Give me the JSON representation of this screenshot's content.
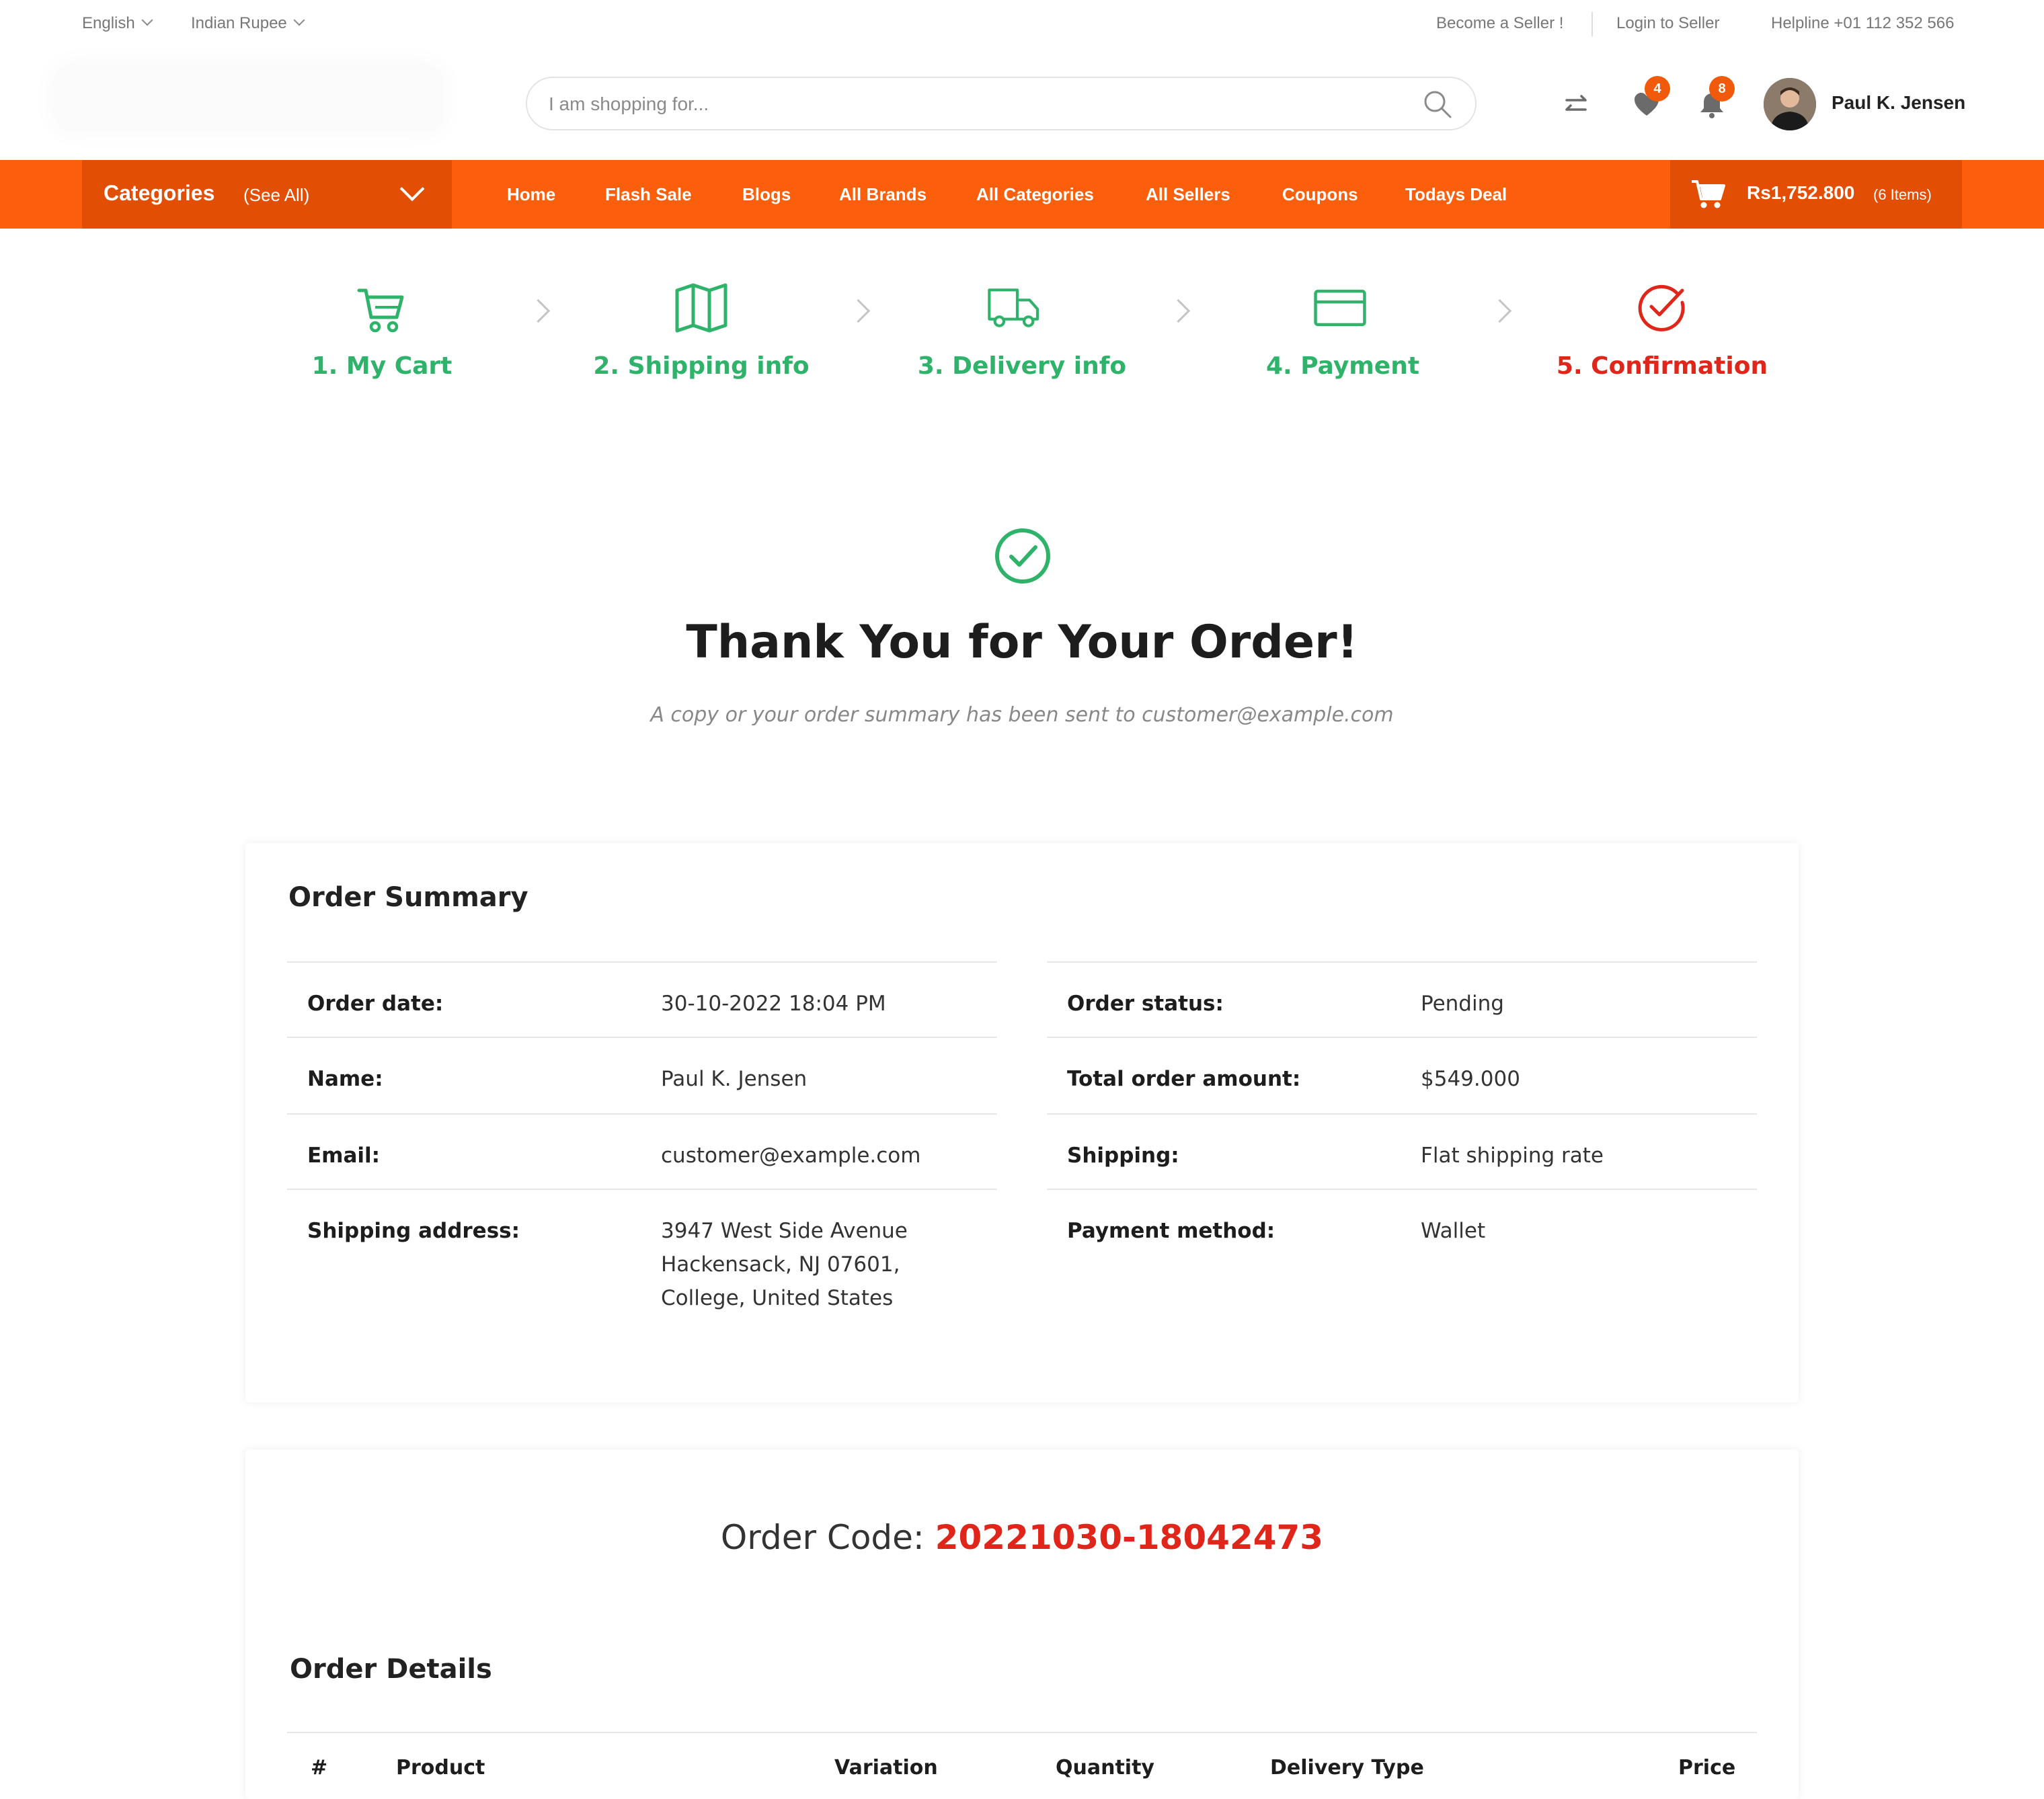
{
  "topbar": {
    "language": "English",
    "currency": "Indian Rupee",
    "become_seller": "Become a Seller !",
    "login_seller": "Login to Seller",
    "helpline": "Helpline +01 112 352 566"
  },
  "header": {
    "search_placeholder": "I am shopping for...",
    "wishlist_count": "4",
    "notification_count": "8",
    "user_name": "Paul K. Jensen",
    "icons": [
      "compare-icon",
      "heart-icon",
      "bell-icon",
      "search-icon"
    ]
  },
  "nav": {
    "categories_label": "Categories",
    "see_all": "(See All)",
    "items": [
      "Home",
      "Flash Sale",
      "Blogs",
      "All Brands",
      "All Categories",
      "All Sellers",
      "Coupons",
      "Todays Deal"
    ],
    "cart_amount": "Rs1,752.800",
    "cart_items": "(6 Items)"
  },
  "steps": [
    {
      "label": "1. My Cart",
      "icon": "cart-icon",
      "color": "#2fb36b"
    },
    {
      "label": "2. Shipping info",
      "icon": "map-icon",
      "color": "#2fb36b"
    },
    {
      "label": "3. Delivery info",
      "icon": "truck-icon",
      "color": "#2fb36b"
    },
    {
      "label": "4. Payment",
      "icon": "credit-card-icon",
      "color": "#2fb36b"
    },
    {
      "label": "5. Confirmation",
      "icon": "check-circle-icon",
      "color": "#e0261a"
    }
  ],
  "thank_you": {
    "title": "Thank You for Your Order!",
    "subtitle": "A copy or your order summary has been sent to customer@example.com"
  },
  "order_summary": {
    "title": "Order Summary",
    "left": [
      {
        "key": "Order date:",
        "value": "30-10-2022 18:04 PM"
      },
      {
        "key": "Name:",
        "value": "Paul K. Jensen"
      },
      {
        "key": "Email:",
        "value": "customer@example.com"
      },
      {
        "key": "Shipping address:",
        "value_lines": [
          "3947 West Side Avenue",
          "Hackensack, NJ 07601,",
          "College, United States"
        ]
      }
    ],
    "right": [
      {
        "key": "Order status:",
        "value": "Pending"
      },
      {
        "key": "Total order amount:",
        "value": "$549.000"
      },
      {
        "key": "Shipping:",
        "value": "Flat shipping rate"
      },
      {
        "key": "Payment method:",
        "value": "Wallet"
      }
    ]
  },
  "order_code": {
    "label": "Order Code:",
    "value": "20221030-18042473"
  },
  "order_details": {
    "title": "Order Details",
    "columns": [
      "#",
      "Product",
      "Variation",
      "Quantity",
      "Delivery Type",
      "Price"
    ]
  },
  "colors": {
    "brand_orange": "#fb5f0b",
    "dark_orange": "#e24f04",
    "green": "#2fb36b",
    "red": "#e0261a"
  }
}
